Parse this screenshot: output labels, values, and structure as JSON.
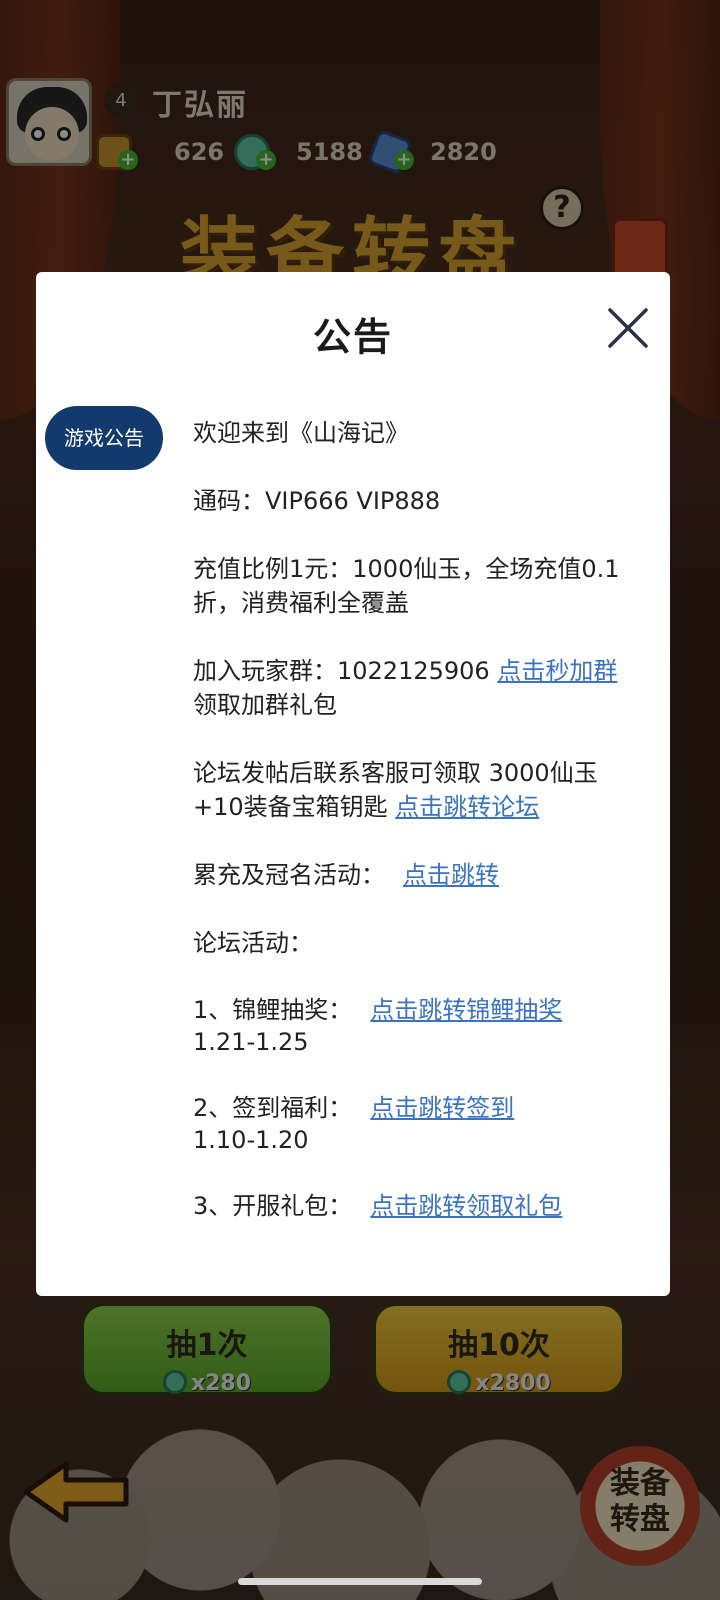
{
  "player": {
    "level": "4",
    "name": "丁弘丽"
  },
  "resources": [
    {
      "icon": "gold-coin-icon",
      "value": "626"
    },
    {
      "icon": "jade-icon",
      "value": "5188"
    },
    {
      "icon": "crystal-icon",
      "value": "2820"
    }
  ],
  "background": {
    "title_art": "装备转盘",
    "draw_once": {
      "label": "抽1次",
      "cost": "x280"
    },
    "draw_ten": {
      "label": "抽10次",
      "cost": "x2800"
    },
    "corner_badge": "装备转盘"
  },
  "modal": {
    "title": "公告",
    "tab_label": "游戏公告",
    "welcome": "欢迎来到《山海记》",
    "code_line": "通码：VIP666 VIP888",
    "recharge_line": "充值比例1元：1000仙玉，全场充值0.1折，消费福利全覆盖",
    "group_text": "加入玩家群：1022125906 ",
    "group_link": "点击秒加群",
    "group_suffix": " 领取加群礼包",
    "forum_text": "论坛发帖后联系客服可领取 3000仙玉+10装备宝箱钥匙 ",
    "forum_link": "点击跳转论坛",
    "accum_text": "累充及冠名活动：",
    "accum_link": "点击跳转",
    "forum_activity": "论坛活动：",
    "activities": [
      {
        "label": "1、锦鲤抽奖：",
        "link": "点击跳转锦鲤抽奖",
        "date": "1.21-1.25"
      },
      {
        "label": "2、签到福利：",
        "link": "点击跳转签到",
        "date": "1.10-1.20"
      },
      {
        "label": "3、开服礼包：",
        "link": "点击跳转领取礼包",
        "date": ""
      }
    ]
  },
  "colors": {
    "tab_bg": "#123a6e",
    "link": "#3a73c2",
    "modal_bg": "#ffffff"
  }
}
